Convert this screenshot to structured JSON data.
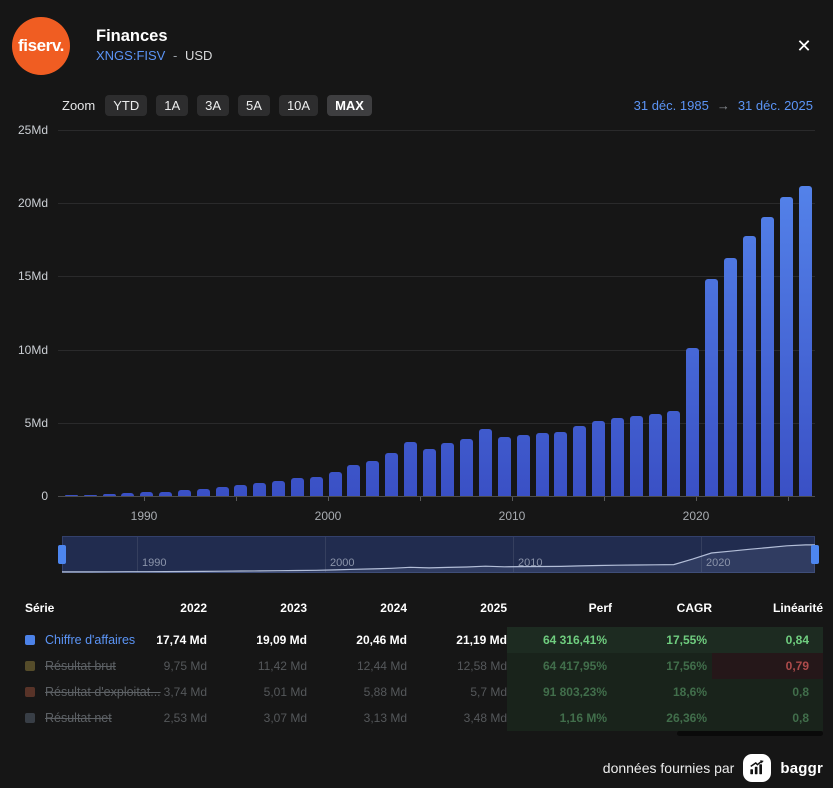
{
  "header": {
    "logo_text": "fiserv.",
    "title": "Finances",
    "ticker": "XNGS:FISV",
    "separator": "-",
    "currency": "USD",
    "close_glyph": "✕"
  },
  "toolbar": {
    "zoom_label": "Zoom",
    "buttons": [
      "YTD",
      "1A",
      "3A",
      "5A",
      "10A",
      "MAX"
    ],
    "active_button": "MAX",
    "range_start": "31 déc. 1985",
    "arrow": "→",
    "range_end": "31 déc. 2025"
  },
  "chart_data": {
    "type": "bar",
    "x": [
      1986,
      1987,
      1988,
      1989,
      1990,
      1991,
      1992,
      1993,
      1994,
      1995,
      1996,
      1997,
      1998,
      1999,
      2000,
      2001,
      2002,
      2003,
      2004,
      2005,
      2006,
      2007,
      2008,
      2009,
      2010,
      2011,
      2012,
      2013,
      2014,
      2015,
      2016,
      2017,
      2018,
      2019,
      2020,
      2021,
      2022,
      2023,
      2024,
      2025
    ],
    "series": [
      {
        "name": "Chiffre d'affaires",
        "values": [
          0.08,
          0.1,
          0.15,
          0.2,
          0.25,
          0.3,
          0.4,
          0.5,
          0.6,
          0.75,
          0.88,
          1.0,
          1.2,
          1.32,
          1.66,
          2.11,
          2.41,
          2.91,
          3.7,
          3.18,
          3.59,
          3.87,
          4.55,
          4.05,
          4.2,
          4.3,
          4.4,
          4.8,
          5.1,
          5.3,
          5.5,
          5.6,
          5.8,
          10.1,
          14.85,
          16.23,
          17.74,
          19.09,
          20.46,
          21.19
        ]
      }
    ],
    "unit": "Md",
    "ylim": [
      0,
      25
    ],
    "yticks": [
      {
        "value": 0,
        "label": "0"
      },
      {
        "value": 5,
        "label": "5Md"
      },
      {
        "value": 10,
        "label": "10Md"
      },
      {
        "value": 15,
        "label": "15Md"
      },
      {
        "value": 20,
        "label": "20Md"
      },
      {
        "value": 25,
        "label": "25Md"
      }
    ],
    "xticks": [
      1990,
      2000,
      2010,
      2020
    ],
    "xticks_minor": [
      1995,
      2005,
      2015,
      2025
    ],
    "grid": true,
    "legend_position": "none",
    "bar_gradient": [
      "#588bf0",
      "#3a50c5"
    ]
  },
  "navigator": {
    "type": "line",
    "labels": [
      1990,
      2000,
      2010,
      2020
    ]
  },
  "table": {
    "columns": [
      "Série",
      "2022",
      "2023",
      "2024",
      "2025",
      "Perf",
      "CAGR",
      "Linéarité"
    ],
    "rows": [
      {
        "name": "Chiffre d'affaires",
        "swatch": "#4c82e8",
        "active": true,
        "values": [
          "17,74 Md",
          "19,09 Md",
          "20,46 Md",
          "21,19 Md"
        ],
        "perf": "64 316,41%",
        "cagr": "17,55%",
        "linearite": "0,84",
        "linearite_state": "green"
      },
      {
        "name": "Résultat brut",
        "swatch": "#8a7a3d",
        "active": false,
        "values": [
          "9,75 Md",
          "11,42 Md",
          "12,44 Md",
          "12,58 Md"
        ],
        "perf": "64 417,95%",
        "cagr": "17,56%",
        "linearite": "0,79",
        "linearite_state": "red"
      },
      {
        "name": "Résultat d'exploitat...",
        "swatch": "#8f4c38",
        "active": false,
        "values": [
          "3,74 Md",
          "5,01 Md",
          "5,88 Md",
          "5,7 Md"
        ],
        "perf": "91 803,23%",
        "cagr": "18,6%",
        "linearite": "0,8",
        "linearite_state": "green"
      },
      {
        "name": "Résultat net",
        "swatch": "#566070",
        "active": false,
        "values": [
          "2,53 Md",
          "3,07 Md",
          "3,13 Md",
          "3,48 Md"
        ],
        "perf": "1,16 M%",
        "cagr": "26,36%",
        "linearite": "0,8",
        "linearite_state": "green"
      }
    ]
  },
  "footer": {
    "text": "données fournies par",
    "brand": "baggr"
  }
}
